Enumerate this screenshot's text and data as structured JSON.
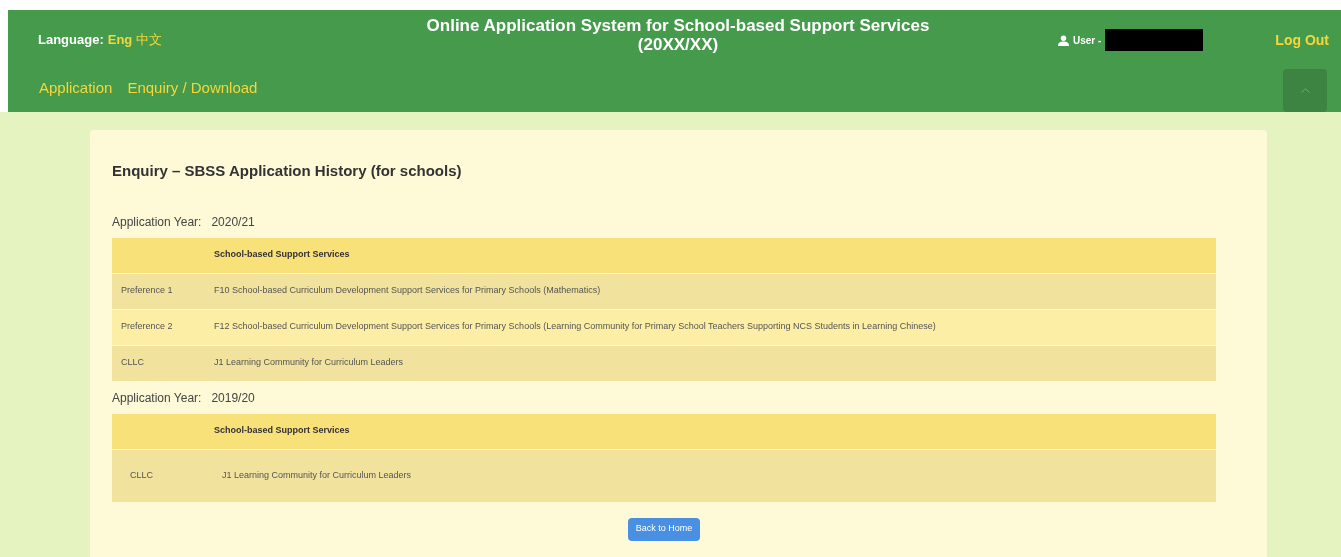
{
  "header": {
    "language_label": "Language:",
    "languages": [
      {
        "label": "Eng",
        "selected": true
      },
      {
        "label": "中文",
        "selected": false
      }
    ],
    "title_line_1": "Online Application System for School-based Support Services",
    "title_line_2": "(20XX/XX)",
    "user_label": "User -",
    "log_out": "Log Out"
  },
  "nav": [
    "Application",
    "Enquiry / Download"
  ],
  "page_title": "Enquiry – SBSS Application History (for schools)",
  "years": [
    {
      "label": "Application Year:",
      "value": "2020/21",
      "header": "School-based Support Services",
      "tall": false,
      "rows": [
        {
          "label": "Preference 1",
          "service": "F10 School-based Curriculum Development Support Services for Primary Schools (Mathematics)"
        },
        {
          "label": "Preference 2",
          "service": "F12 School-based Curriculum Development Support Services for Primary Schools (Learning Community for Primary School Teachers Supporting NCS Students in Learning Chinese)"
        },
        {
          "label": "CLLC",
          "service": "J1 Learning Community for Curriculum Leaders"
        }
      ]
    },
    {
      "label": "Application Year:",
      "value": "2019/20",
      "header": "School-based Support Services",
      "tall": true,
      "rows": [
        {
          "label": "CLLC",
          "service": "J1 Learning Community for Curriculum Leaders"
        }
      ]
    }
  ],
  "back_button": "Back to Home"
}
